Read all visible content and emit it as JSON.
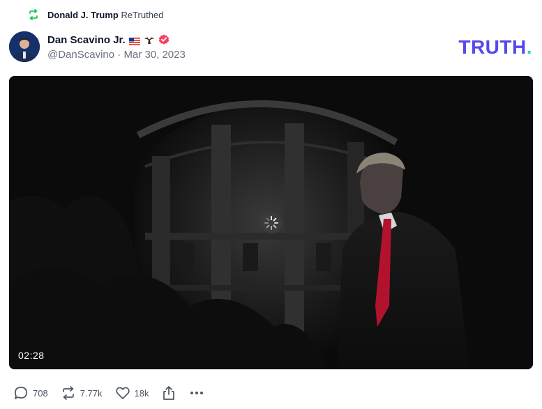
{
  "retruth": {
    "user": "Donald J. Trump",
    "label": "ReTruthed"
  },
  "post": {
    "author_name": "Dan Scavino Jr.",
    "handle_and_date": "@DanScavino · Mar 30, 2023"
  },
  "brand": {
    "logo_text": "TRUTH",
    "logo_dot": "."
  },
  "video": {
    "duration": "02:28"
  },
  "actions": {
    "replies": "708",
    "retruths": "7.77k",
    "likes": "18k"
  },
  "colors": {
    "brand": "#5448ee",
    "brand_dot": "#3ad0a6",
    "retruth_green": "#22c55e",
    "verified": "#f43f5e"
  },
  "icons": {
    "retruth": "retruth-arrows-icon",
    "reply": "speech-bubble-icon",
    "like": "heart-icon",
    "share": "share-upload-icon",
    "more": "ellipsis-icon",
    "verified": "verified-badge-icon",
    "spinner": "loading-spinner-icon"
  }
}
